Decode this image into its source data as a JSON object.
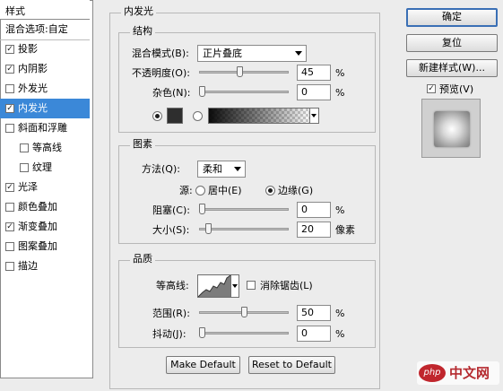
{
  "style_list": {
    "header": "样式",
    "items": [
      {
        "label": "混合选项:自定",
        "checkbox": false,
        "checked": false,
        "selected": false,
        "indent": false
      },
      {
        "label": "投影",
        "checkbox": true,
        "checked": true,
        "selected": false,
        "indent": false
      },
      {
        "label": "内阴影",
        "checkbox": true,
        "checked": true,
        "selected": false,
        "indent": false
      },
      {
        "label": "外发光",
        "checkbox": true,
        "checked": false,
        "selected": false,
        "indent": false
      },
      {
        "label": "内发光",
        "checkbox": true,
        "checked": true,
        "selected": true,
        "indent": false
      },
      {
        "label": "斜面和浮雕",
        "checkbox": true,
        "checked": false,
        "selected": false,
        "indent": false
      },
      {
        "label": "等高线",
        "checkbox": true,
        "checked": false,
        "selected": false,
        "indent": true
      },
      {
        "label": "纹理",
        "checkbox": true,
        "checked": false,
        "selected": false,
        "indent": true
      },
      {
        "label": "光泽",
        "checkbox": true,
        "checked": true,
        "selected": false,
        "indent": false
      },
      {
        "label": "颜色叠加",
        "checkbox": true,
        "checked": false,
        "selected": false,
        "indent": false
      },
      {
        "label": "渐变叠加",
        "checkbox": true,
        "checked": true,
        "selected": false,
        "indent": false
      },
      {
        "label": "图案叠加",
        "checkbox": true,
        "checked": false,
        "selected": false,
        "indent": false
      },
      {
        "label": "描边",
        "checkbox": true,
        "checked": false,
        "selected": false,
        "indent": false
      }
    ]
  },
  "inner_glow": {
    "title": "内发光",
    "structure": {
      "title": "结构",
      "blend_mode_label": "混合模式(B):",
      "blend_mode_value": "正片叠底",
      "opacity_label": "不透明度(O):",
      "opacity_value": "45",
      "opacity_unit": "%",
      "opacity_level": 0.45,
      "noise_label": "杂色(N):",
      "noise_value": "0",
      "noise_unit": "%",
      "noise_level": 0.0,
      "color_mode": "solid"
    },
    "elements": {
      "title": "图素",
      "method_label": "方法(Q):",
      "method_value": "柔和",
      "source_label": "源:",
      "source_center_label": "居中(E)",
      "source_edge_label": "边缘(G)",
      "source_selected": "edge",
      "choke_label": "阻塞(C):",
      "choke_value": "0",
      "choke_unit": "%",
      "choke_level": 0.0,
      "size_label": "大小(S):",
      "size_value": "20",
      "size_unit": "像素",
      "size_level": 0.08
    },
    "quality": {
      "title": "品质",
      "contour_label": "等高线:",
      "antialias_label": "消除锯齿(L)",
      "antialias_checked": false,
      "range_label": "范围(R):",
      "range_value": "50",
      "range_unit": "%",
      "range_level": 0.5,
      "jitter_label": "抖动(J):",
      "jitter_value": "0",
      "jitter_unit": "%",
      "jitter_level": 0.0
    },
    "make_default_label": "Make Default",
    "reset_default_label": "Reset to Default"
  },
  "actions": {
    "ok_label": "确定",
    "reset_label": "复位",
    "new_style_label": "新建样式(W)...",
    "preview_label": "预览(V)",
    "preview_checked": true
  },
  "watermark": {
    "logo": "php",
    "text": "中文网"
  }
}
